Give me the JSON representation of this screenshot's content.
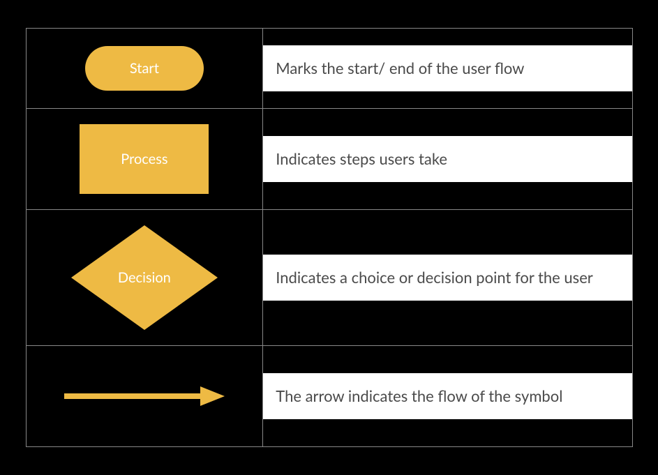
{
  "colors": {
    "shape": "#eeba44",
    "text": "#4a4a4a",
    "label": "#ffffff"
  },
  "rows": [
    {
      "key": "start",
      "label": "Start",
      "description": "Marks the start/ end of the user flow"
    },
    {
      "key": "process",
      "label": "Process",
      "description": "Indicates steps users take"
    },
    {
      "key": "decision",
      "label": "Decision",
      "description": "Indicates a choice or decision point for the user"
    },
    {
      "key": "arrow",
      "label": "",
      "description": "The arrow indicates the flow of the symbol"
    }
  ]
}
